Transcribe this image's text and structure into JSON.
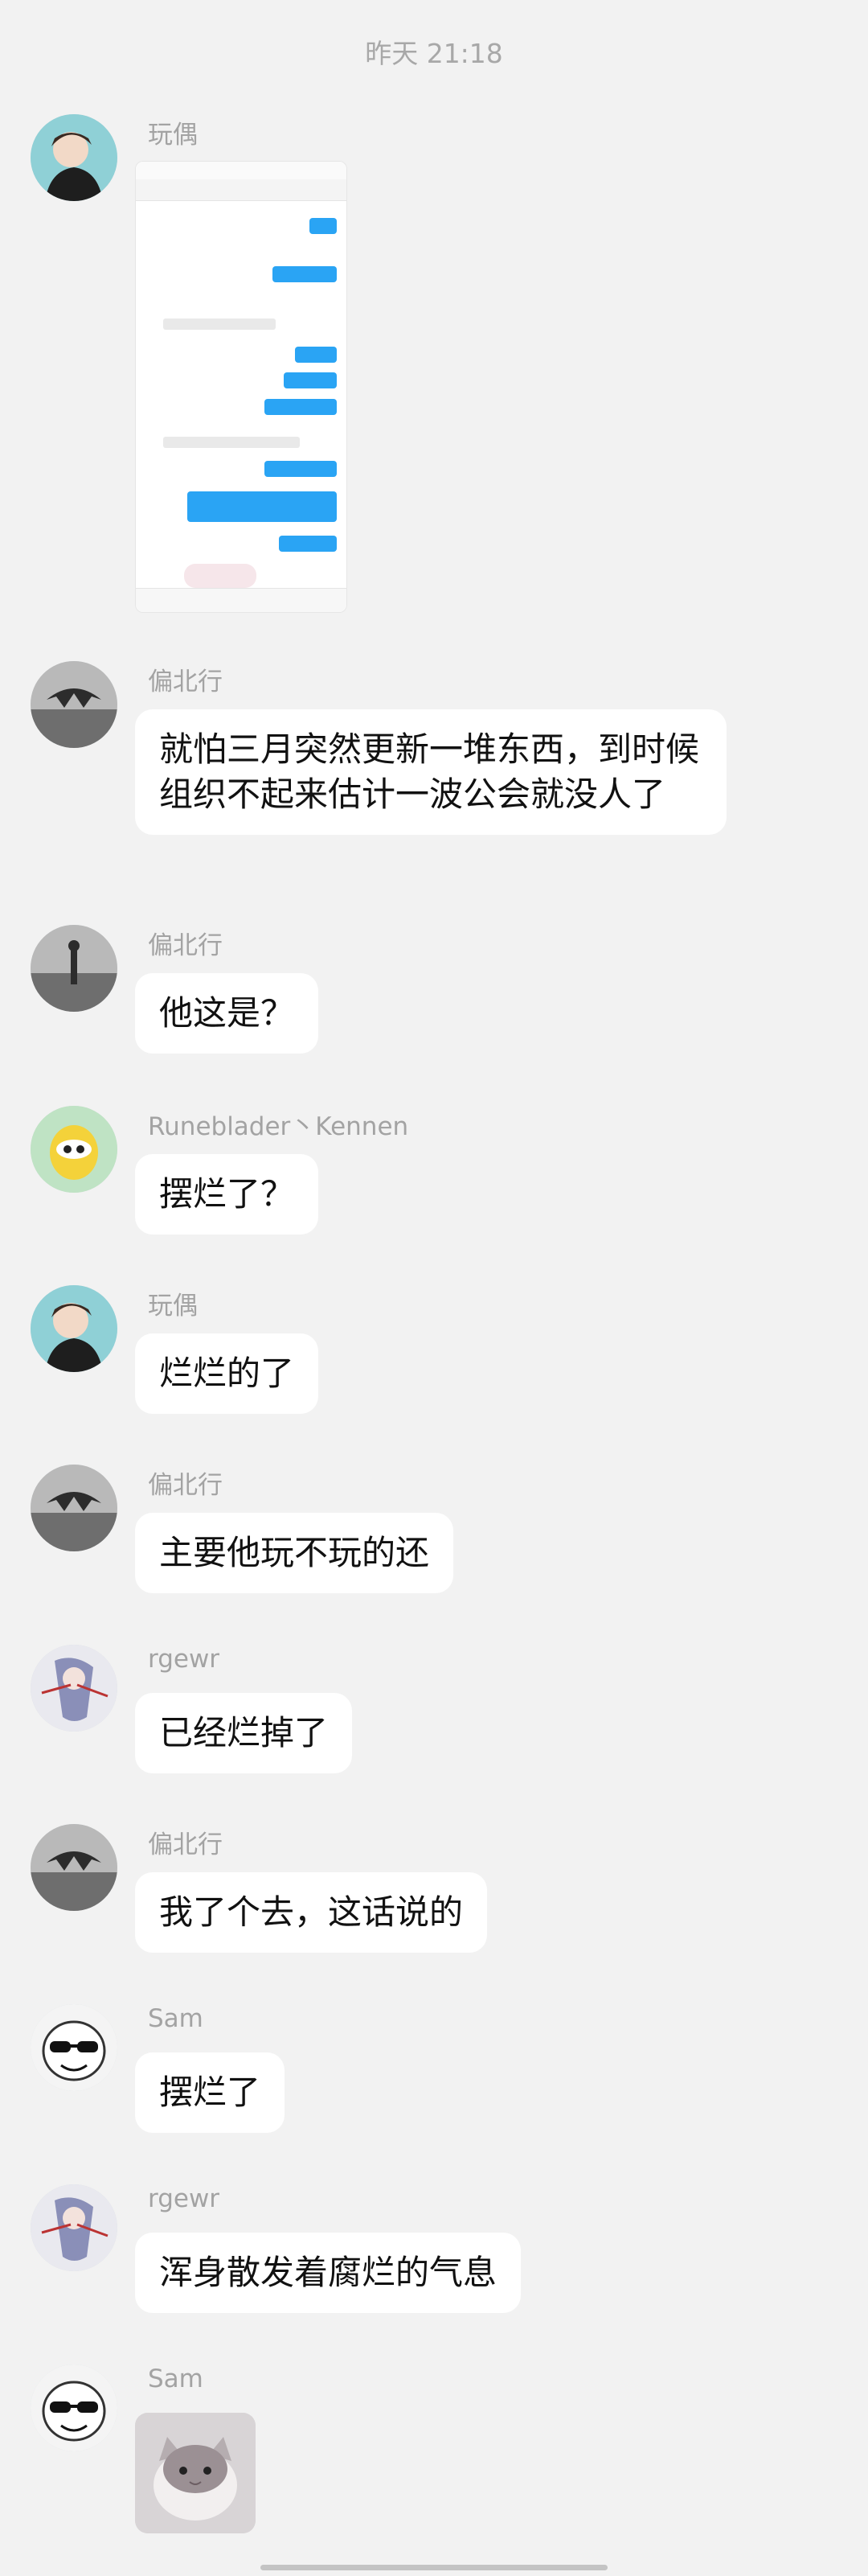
{
  "timestamp": "昨天 21:18",
  "messages": [
    {
      "sender": "玩偶",
      "type": "image",
      "avatar_icon": "anime-boy-avatar"
    },
    {
      "sender": "偏北行",
      "text": "就怕三月突然更新一堆东西，到时候组织不起来估计一波公会就没人了",
      "avatar_icon": "dark-crest-avatar"
    },
    {
      "sender": "偏北行",
      "text": "他这是？",
      "avatar_icon": "dark-crest-avatar"
    },
    {
      "sender": "Runeblader丶Kennen",
      "text": "摆烂了？",
      "avatar_icon": "yellow-creature-avatar"
    },
    {
      "sender": "玩偶",
      "text": "烂烂的了",
      "avatar_icon": "anime-boy-avatar"
    },
    {
      "sender": "偏北行",
      "text": "主要他玩不玩的还",
      "avatar_icon": "dark-crest-avatar"
    },
    {
      "sender": "rgewr",
      "text": "已经烂掉了",
      "avatar_icon": "anime-girl-avatar"
    },
    {
      "sender": "偏北行",
      "text": "我了个去，这话说的",
      "avatar_icon": "dark-crest-avatar"
    },
    {
      "sender": "Sam",
      "text": "摆烂了",
      "avatar_icon": "sunglasses-meme-avatar"
    },
    {
      "sender": "rgewr",
      "text": "浑身散发着腐烂的气息",
      "avatar_icon": "anime-girl-avatar"
    },
    {
      "sender": "Sam",
      "type": "image",
      "avatar_icon": "sunglasses-meme-avatar"
    }
  ]
}
